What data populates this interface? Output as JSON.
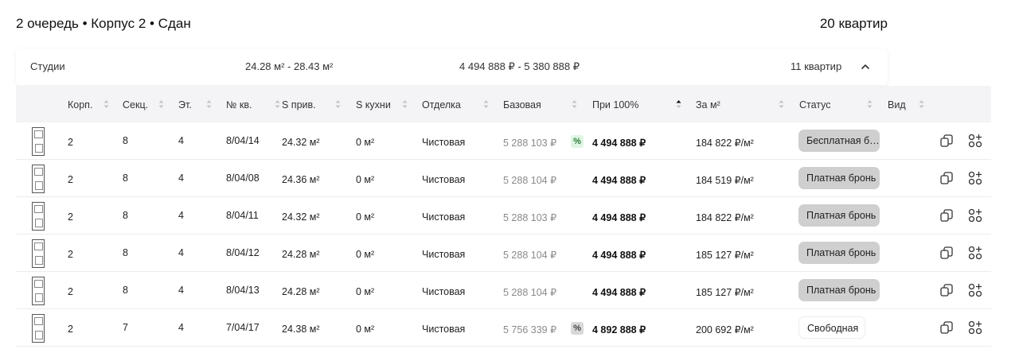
{
  "header": {
    "title": "2 очередь • Корпус 2 • Сдан",
    "count": "20 квартир"
  },
  "group": {
    "name": "Студии",
    "area_range": "24.28 м² - 28.43 м²",
    "price_range": "4 494 888 ₽ - 5 380 888 ₽",
    "count": "11 квартир",
    "expanded": true
  },
  "columns": [
    {
      "key": "korp",
      "label": "Корп."
    },
    {
      "key": "sek",
      "label": "Секц."
    },
    {
      "key": "et",
      "label": "Эт."
    },
    {
      "key": "num",
      "label": "№ кв."
    },
    {
      "key": "area",
      "label": "S прив."
    },
    {
      "key": "kitchen",
      "label": "S кухни"
    },
    {
      "key": "finish",
      "label": "Отделка"
    },
    {
      "key": "base",
      "label": "Базовая"
    },
    {
      "key": "full",
      "label": "При 100%",
      "sorted": "asc"
    },
    {
      "key": "sqm",
      "label": "За м²"
    },
    {
      "key": "status",
      "label": "Статус"
    },
    {
      "key": "view",
      "label": "Вид"
    }
  ],
  "rows": [
    {
      "korp": "2",
      "sek": "8",
      "et": "4",
      "num": "8/04/14",
      "area": "24.32 м²",
      "kitchen": "0 м²",
      "finish": "Чистовая",
      "base": "5 288 103 ₽",
      "badge": "%",
      "badge_color": "#dff5e3",
      "full": "4 494 888 ₽",
      "sqm": "184 822 ₽/м²",
      "status": "Бесплатная бронь",
      "status_type": "booked"
    },
    {
      "korp": "2",
      "sek": "8",
      "et": "4",
      "num": "8/04/08",
      "area": "24.36 м²",
      "kitchen": "0 м²",
      "finish": "Чистовая",
      "base": "5 288 104 ₽",
      "badge": "",
      "full": "4 494 888 ₽",
      "sqm": "184 519 ₽/м²",
      "status": "Платная бронь",
      "status_type": "booked"
    },
    {
      "korp": "2",
      "sek": "8",
      "et": "4",
      "num": "8/04/11",
      "area": "24.32 м²",
      "kitchen": "0 м²",
      "finish": "Чистовая",
      "base": "5 288 103 ₽",
      "badge": "",
      "full": "4 494 888 ₽",
      "sqm": "184 822 ₽/м²",
      "status": "Платная бронь",
      "status_type": "booked"
    },
    {
      "korp": "2",
      "sek": "8",
      "et": "4",
      "num": "8/04/12",
      "area": "24.28 м²",
      "kitchen": "0 м²",
      "finish": "Чистовая",
      "base": "5 288 104 ₽",
      "badge": "",
      "full": "4 494 888 ₽",
      "sqm": "185 127 ₽/м²",
      "status": "Платная бронь",
      "status_type": "booked"
    },
    {
      "korp": "2",
      "sek": "8",
      "et": "4",
      "num": "8/04/13",
      "area": "24.28 м²",
      "kitchen": "0 м²",
      "finish": "Чистовая",
      "base": "5 288 104 ₽",
      "badge": "",
      "full": "4 494 888 ₽",
      "sqm": "185 127 ₽/м²",
      "status": "Платная бронь",
      "status_type": "booked"
    },
    {
      "korp": "2",
      "sek": "7",
      "et": "4",
      "num": "7/04/17",
      "area": "24.38 м²",
      "kitchen": "0 м²",
      "finish": "Чистовая",
      "base": "5 756 339 ₽",
      "badge": "%",
      "badge_color": "#d9d9d9",
      "full": "4 892 888 ₽",
      "sqm": "200 692 ₽/м²",
      "status": "Свободная",
      "status_type": "free"
    }
  ],
  "icons": {
    "copy": "copy-icon",
    "add": "add-to-compare-icon",
    "chevron": "chevron-up-icon",
    "plan": "floor-plan-thumbnail"
  }
}
